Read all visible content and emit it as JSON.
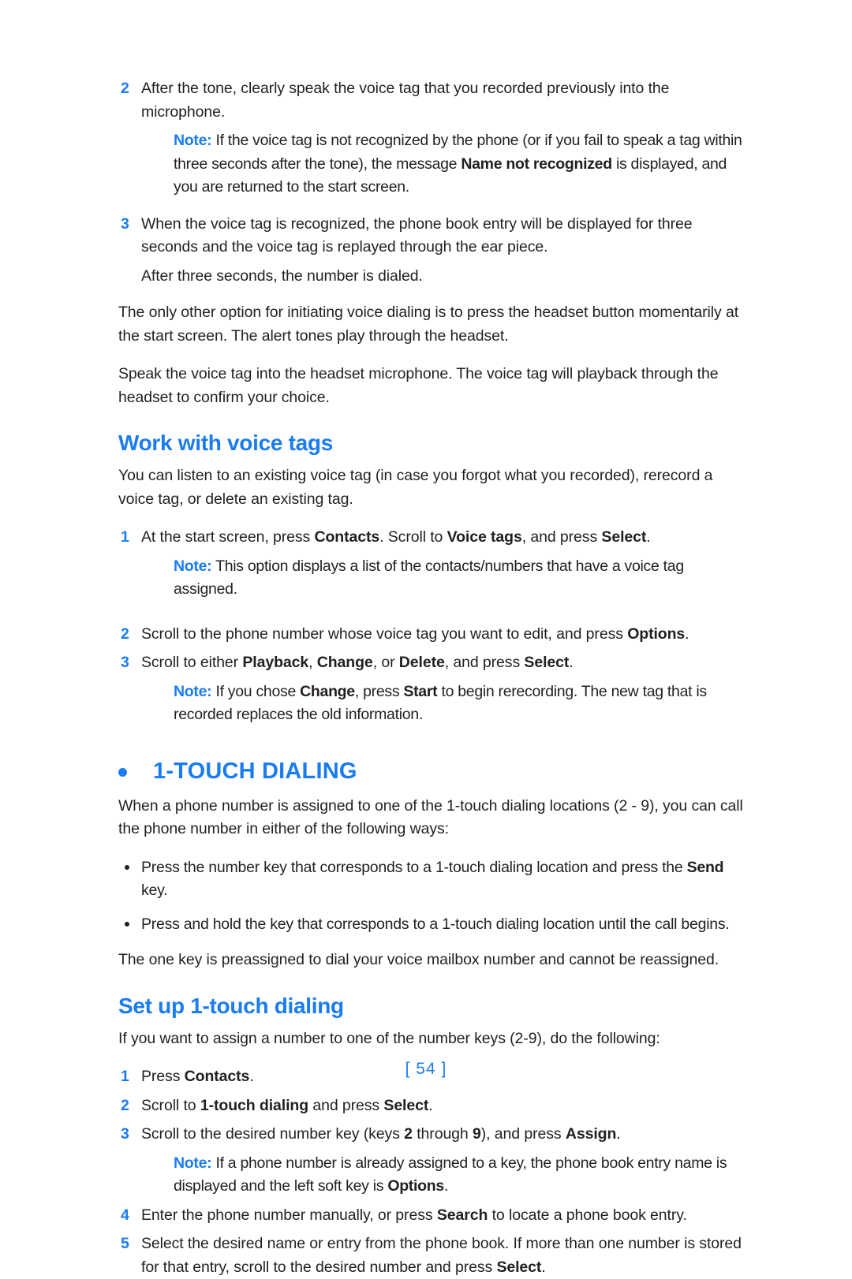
{
  "page": {
    "folio": "[ 54 ]",
    "accent_color": "#1a7cf0",
    "text_color": "#231f20"
  },
  "blocks": {
    "step2_tone": {
      "num": "2",
      "text": "After the tone, clearly speak the voice tag that you recorded previously into the microphone."
    },
    "note_not_recognized": {
      "label": "Note:",
      "part1": " If the voice tag is not recognized by the phone (or if you fail to speak a tag within three seconds after the tone), the message ",
      "bold1": "Name not recognized",
      "part2": " is displayed, and you are returned to the start screen."
    },
    "step3_recognized": {
      "num": "3",
      "text": "When the voice tag is recognized, the phone book entry will be displayed for three seconds and the voice tag is replayed through the ear piece."
    },
    "after_three_seconds": {
      "text": "After three seconds, the number is dialed."
    },
    "para_only_other_option": {
      "text": "The only other option for initiating voice dialing is to press the headset button momentarily at the start screen. The alert tones play through the headset."
    },
    "para_speak_voice_tag": {
      "text": "Speak the voice tag into the headset microphone. The voice tag will playback through the headset to confirm your choice."
    },
    "heading_work_with_voice_tags": "Work with voice tags",
    "para_you_can_listen": {
      "text": "You can listen to an existing voice tag (in case you forgot what you recorded), rerecord a voice tag, or delete an existing tag."
    },
    "step1_voice_tags": {
      "num": "1",
      "part1": "At the start screen, press ",
      "bold1": "Contacts",
      "part2": ". Scroll to ",
      "bold2": "Voice tags",
      "part3": ", and press ",
      "bold3": "Select",
      "part4": "."
    },
    "note_list_of_contacts": {
      "label": "Note:",
      "text": " This option displays a list of the contacts/numbers that have a voice tag assigned."
    },
    "step2_scroll_phone_number": {
      "num": "2",
      "part1": "Scroll to the phone number whose voice tag you want to edit, and press ",
      "bold1": "Options",
      "part2": "."
    },
    "step3_playback_change_delete": {
      "num": "3",
      "part1": "Scroll to either ",
      "bold1": "Playback",
      "part2": ", ",
      "bold2": "Change",
      "part3": ", or ",
      "bold3": "Delete",
      "part4": ", and press ",
      "bold4": "Select",
      "part5": "."
    },
    "note_if_you_chose_change": {
      "label": "Note:",
      "part1": " If you chose ",
      "bold1": "Change",
      "part2": ", press ",
      "bold2": "Start",
      "part3": " to begin rerecording. The new tag that is recorded replaces the old information."
    },
    "heading_one_touch_dialing": "1-TOUCH DIALING",
    "para_when_a_phone_number": {
      "text": "When a phone number is assigned to one of the 1-touch dialing locations (2 - 9), you can call the phone number in either of the following ways:"
    },
    "bullet_press_number_key": {
      "part1": "Press the number key that corresponds to a 1-touch dialing location and press the ",
      "bold1": "Send",
      "part2": " key."
    },
    "bullet_press_and_hold": {
      "text": "Press and hold the key that corresponds to a 1-touch dialing location until the call begins."
    },
    "para_one_key_preassigned": {
      "text": "The one key is preassigned to dial your voice mailbox number and cannot be reassigned."
    },
    "heading_set_up_one_touch": "Set up 1-touch dialing",
    "para_if_you_want_to_assign": {
      "text": "If you want to assign a number to one of the number keys (2-9), do the following:"
    },
    "step1_press_contacts": {
      "num": "1",
      "part1": "Press ",
      "bold1": "Contacts",
      "part2": "."
    },
    "step2_scroll_one_touch": {
      "num": "2",
      "part1": "Scroll to ",
      "bold1": "1-touch dialing",
      "part2": " and press ",
      "bold2": "Select",
      "part3": "."
    },
    "step3_scroll_desired_key": {
      "num": "3",
      "part1": "Scroll to the desired number key (keys ",
      "bold1": "2",
      "part2": " through ",
      "bold2": "9",
      "part3": "), and press ",
      "bold3": "Assign",
      "part4": "."
    },
    "note_already_assigned": {
      "label": "Note:",
      "part1": " If a phone number is already assigned to a key, the phone book entry name is displayed and the left soft key is ",
      "bold1": "Options",
      "part2": "."
    },
    "step4_enter_phone_number": {
      "num": "4",
      "part1": "Enter the phone number manually, or press ",
      "bold1": "Search",
      "part2": " to locate a phone book entry."
    },
    "step5_select_desired_name": {
      "num": "5",
      "part1": "Select the desired name or entry from the phone book. If more than one number is stored for that entry, scroll to the desired number and press ",
      "bold1": "Select",
      "part2": "."
    }
  }
}
